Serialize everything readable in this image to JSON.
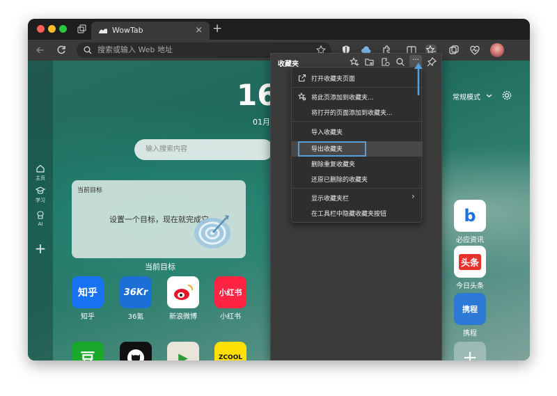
{
  "browser": {
    "tab_title": "WowTab",
    "tab_close": "×",
    "new_tab": "+",
    "address_placeholder": "搜索或输入 Web 地址"
  },
  "sidebar": {
    "items": [
      {
        "label": "主页",
        "icon": "home-icon"
      },
      {
        "label": "学习",
        "icon": "graduation-cap-icon"
      },
      {
        "label": "AI",
        "icon": "ai-bot-icon"
      }
    ],
    "add_label": "+"
  },
  "newtab": {
    "clock": "16",
    "date": "01月",
    "search_placeholder": "输入搜索内容",
    "goal_title": "当前目标",
    "goal_text": "设置一个目标，现在就完成它",
    "goal_caption": "当前目标",
    "mode_label": "常规模式",
    "apps": [
      {
        "name": "知乎",
        "icon_text": "知乎",
        "bg": "#1772f6",
        "color": "#ffffff"
      },
      {
        "name": "36氪",
        "icon_text": "36Kr",
        "bg": "#1d6fd8",
        "color": "#ffffff"
      },
      {
        "name": "新浪微博",
        "icon_text": "微",
        "bg": "#ffffff",
        "color": "#e6162d"
      },
      {
        "name": "小红书",
        "icon_text": "小红书",
        "bg": "#ff2442",
        "color": "#ffffff"
      },
      {
        "name": "必应资讯",
        "icon_text": "b",
        "bg": "#ffffff",
        "color": "#1e73d8"
      },
      {
        "name": "今日头条",
        "icon_text": "头条",
        "bg": "#ffffff",
        "color": "#e5322d"
      },
      {
        "name": "携程",
        "icon_text": "携程",
        "bg": "#2c7ad6",
        "color": "#ffffff"
      }
    ],
    "row2_apps": [
      {
        "icon_text": "豆",
        "bg": "#1aa82c",
        "color": "#ffffff"
      },
      {
        "icon_text": "",
        "bg": "#111111",
        "color": "#ffffff"
      },
      {
        "icon_text": "▶",
        "bg": "#e8e6d9",
        "color": "#2f9a3e"
      },
      {
        "icon_text": "ZCOOL",
        "bg": "#ffe000",
        "color": "#111111"
      },
      {
        "icon_text": "+",
        "bg": "rgba(255,255,255,0.3)",
        "color": "#ffffff"
      }
    ]
  },
  "favorites_panel": {
    "title": "收藏夹",
    "more_label": "···"
  },
  "menu": {
    "items": [
      {
        "label": "打开收藏夹页面",
        "icon": "open-external-icon"
      },
      {
        "label": "将此页添加到收藏夹...",
        "icon": "star-add-icon"
      },
      {
        "label": "将打开的页面添加到收藏夹...",
        "icon": ""
      },
      {
        "label": "导入收藏夹",
        "icon": ""
      },
      {
        "label": "导出收藏夹",
        "icon": ""
      },
      {
        "label": "删除重复收藏夹",
        "icon": ""
      },
      {
        "label": "还原已删除的收藏夹",
        "icon": ""
      },
      {
        "label": "显示收藏夹栏",
        "icon": "",
        "submenu": "›"
      },
      {
        "label": "在工具栏中隐藏收藏夹按钮",
        "icon": ""
      }
    ]
  },
  "colors": {
    "accent": "#5aa0d8",
    "traffic_red": "#ff5f57",
    "traffic_yellow": "#febc2e",
    "traffic_green": "#28c840"
  }
}
